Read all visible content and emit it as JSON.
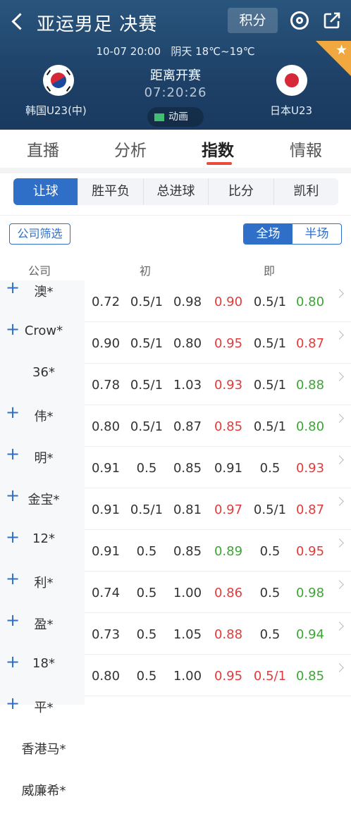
{
  "header": {
    "title": "亚运男足 决赛",
    "jifen_label": "积分",
    "datetime": "10-07 20:00",
    "weather": "阴天 18℃~19℃",
    "home_team": "韩国U23(中)",
    "away_team": "日本U23",
    "status": "距离开赛",
    "countdown": "07:20:26",
    "anim_label": "动画",
    "star": "★"
  },
  "tabs": [
    "直播",
    "分析",
    "指数",
    "情報"
  ],
  "segments": [
    "让球",
    "胜平负",
    "总进球",
    "比分",
    "凯利"
  ],
  "filter_label": "公司筛选",
  "range": [
    "全场",
    "半场"
  ],
  "columns": {
    "company": "公司",
    "initial": "初",
    "instant": "即"
  },
  "rows": [
    {
      "plus": "+",
      "company": "澳*",
      "v": [
        "0.72",
        "0.5/1",
        "0.98",
        "0.90",
        "0.5/1",
        "0.80"
      ],
      "colors": [
        "black",
        "black",
        "black",
        "red",
        "black",
        "green"
      ]
    },
    {
      "plus": "+",
      "company": "Crow*",
      "v": [
        "0.90",
        "0.5/1",
        "0.80",
        "0.95",
        "0.5/1",
        "0.87"
      ],
      "colors": [
        "black",
        "black",
        "black",
        "red",
        "black",
        "red"
      ]
    },
    {
      "plus": "",
      "company": "36*",
      "v": [
        "0.78",
        "0.5/1",
        "1.03",
        "0.93",
        "0.5/1",
        "0.88"
      ],
      "colors": [
        "black",
        "black",
        "black",
        "red",
        "black",
        "green"
      ]
    },
    {
      "plus": "+",
      "company": "伟*",
      "v": [
        "0.80",
        "0.5/1",
        "0.87",
        "0.85",
        "0.5/1",
        "0.80"
      ],
      "colors": [
        "black",
        "black",
        "black",
        "red",
        "black",
        "green"
      ]
    },
    {
      "plus": "+",
      "company": "明*",
      "v": [
        "0.91",
        "0.5",
        "0.85",
        "0.91",
        "0.5",
        "0.93"
      ],
      "colors": [
        "black",
        "black",
        "black",
        "black",
        "black",
        "red"
      ]
    },
    {
      "plus": "+",
      "company": "金宝*",
      "v": [
        "0.91",
        "0.5/1",
        "0.81",
        "0.97",
        "0.5/1",
        "0.87"
      ],
      "colors": [
        "black",
        "black",
        "black",
        "red",
        "black",
        "red"
      ]
    },
    {
      "plus": "+",
      "company": "12*",
      "v": [
        "0.91",
        "0.5",
        "0.85",
        "0.89",
        "0.5",
        "0.95"
      ],
      "colors": [
        "black",
        "black",
        "black",
        "green",
        "black",
        "red"
      ]
    },
    {
      "plus": "+",
      "company": "利*",
      "v": [
        "0.74",
        "0.5",
        "1.00",
        "0.86",
        "0.5",
        "0.98"
      ],
      "colors": [
        "black",
        "black",
        "black",
        "red",
        "black",
        "green"
      ]
    },
    {
      "plus": "+",
      "company": "盈*",
      "v": [
        "0.73",
        "0.5",
        "1.05",
        "0.88",
        "0.5",
        "0.94"
      ],
      "colors": [
        "black",
        "black",
        "black",
        "red",
        "black",
        "green"
      ]
    },
    {
      "plus": "+",
      "company": "18*",
      "v": [
        "0.80",
        "0.5",
        "1.00",
        "0.95",
        "0.5/1",
        "0.85"
      ],
      "colors": [
        "black",
        "black",
        "black",
        "red",
        "red",
        "green"
      ]
    },
    {
      "plus": "+",
      "company": "平*",
      "v": [
        "",
        "",
        "",
        "",
        "",
        ""
      ],
      "colors": [
        "black",
        "black",
        "black",
        "black",
        "black",
        "black"
      ]
    },
    {
      "plus": "",
      "company": "香港马*",
      "v": [
        "",
        "",
        "",
        "",
        "",
        ""
      ],
      "colors": [
        "black",
        "black",
        "black",
        "black",
        "black",
        "black"
      ]
    },
    {
      "plus": "",
      "company": "威廉希*",
      "v": [
        "",
        "",
        "",
        "",
        "",
        ""
      ],
      "colors": [
        "black",
        "black",
        "black",
        "black",
        "black",
        "black"
      ]
    }
  ]
}
